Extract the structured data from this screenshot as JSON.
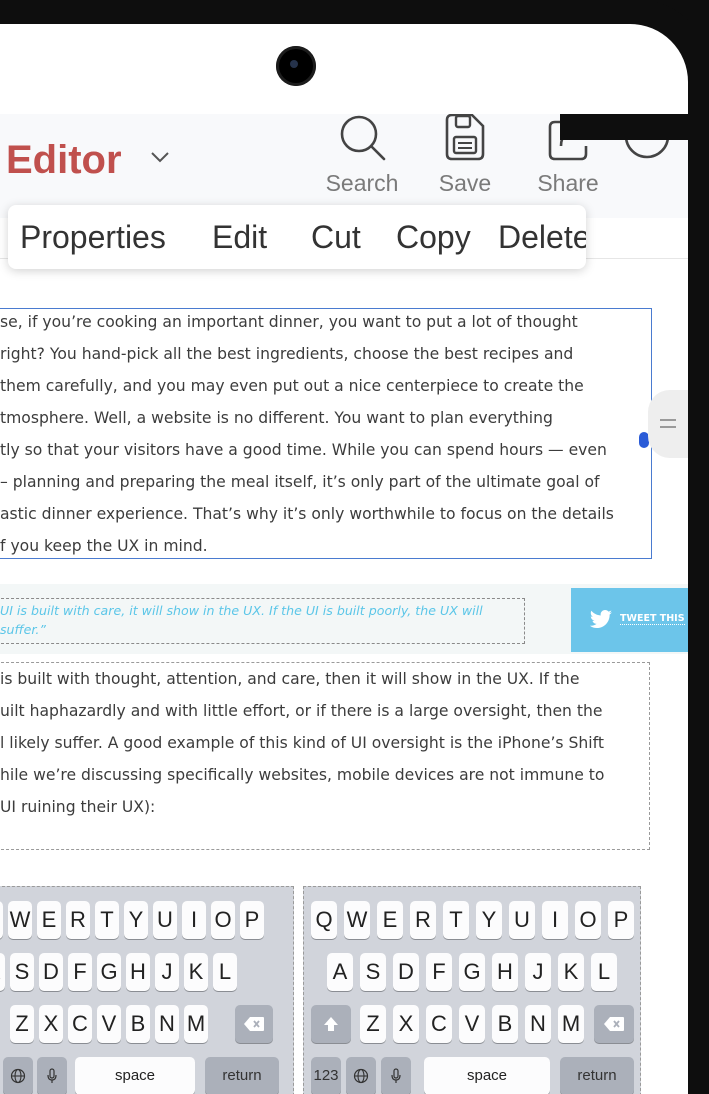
{
  "header": {
    "title": "Editor",
    "tools": [
      {
        "label": "Search",
        "icon": "search-icon"
      },
      {
        "label": "Save",
        "icon": "save-icon"
      },
      {
        "label": "Share",
        "icon": "share-icon"
      },
      {
        "label": "",
        "icon": "more-icon"
      }
    ]
  },
  "context_menu": {
    "items": [
      "Properties",
      "Edit",
      "Cut",
      "Copy",
      "Delete"
    ]
  },
  "article": {
    "selected_paragraph": [
      "se, if you’re cooking an important dinner, you want to put a lot of thought",
      " right? You hand-pick all the best ingredients, choose the best recipes and",
      " them carefully, and you may even put out a nice centerpiece to create the",
      "tmosphere. Well, a website is no different. You want to plan everything",
      "tly so that your visitors have a good time. While you can spend hours — even",
      "– planning and preparing the meal itself, it’s only part of the ultimate goal of",
      "astic dinner experience. That’s why it’s only worthwhile to focus on the details",
      "f you keep the UX in mind."
    ],
    "quote": [
      "UI is built with care, it will show in the UX. If the UI is built poorly, the UX will",
      "suffer.”"
    ],
    "tweet_label": "TWEET THIS",
    "second_paragraph": [
      "is built with thought, attention, and care, then it will show in the UX. If the",
      "uilt haphazardly and with little effort, or if there is a large oversight, then the",
      "l likely suffer. A good example of this kind of UI oversight is the iPhone’s Shift",
      "hile we’re discussing specifically websites, mobile devices are not immune to",
      "UI ruining their UX):"
    ]
  },
  "keyboard": {
    "row1": [
      "Q",
      "W",
      "E",
      "R",
      "T",
      "Y",
      "U",
      "I",
      "O",
      "P"
    ],
    "row2": [
      "A",
      "S",
      "D",
      "F",
      "G",
      "H",
      "J",
      "K",
      "L"
    ],
    "row3": [
      "Z",
      "X",
      "C",
      "V",
      "B",
      "N",
      "M"
    ],
    "numbers_key": "123",
    "space_key": "space",
    "return_key": "return"
  }
}
